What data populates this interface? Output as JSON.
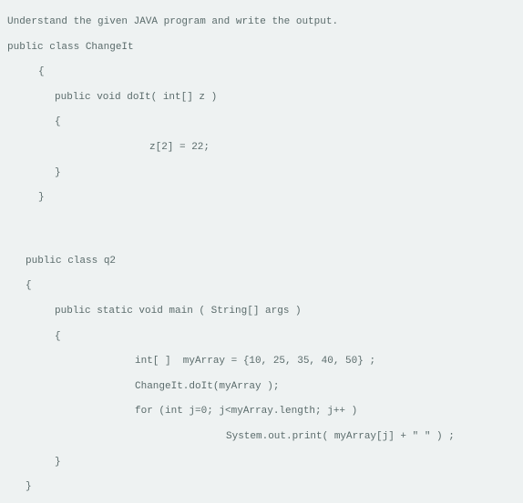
{
  "lines": {
    "l0": "Understand the given JAVA program and write the output.",
    "l1": "public class ChangeIt",
    "l2": "{",
    "l3": "public void doIt( int[] z )",
    "l4": "{",
    "l5": "z[2] = 22;",
    "l6": "}",
    "l7": "}",
    "l8": "public class q2",
    "l9": "{",
    "l10": "public static void main ( String[] args )",
    "l11": "{",
    "l12": "int[ ]  myArray = {10, 25, 35, 40, 50} ;",
    "l13": "ChangeIt.doIt(myArray );",
    "l14": "for (int j=0; j<myArray.length; j++ )",
    "l15": "System.out.print( myArray[j] + \" \" ) ;",
    "l16": "}",
    "l17": "}"
  }
}
